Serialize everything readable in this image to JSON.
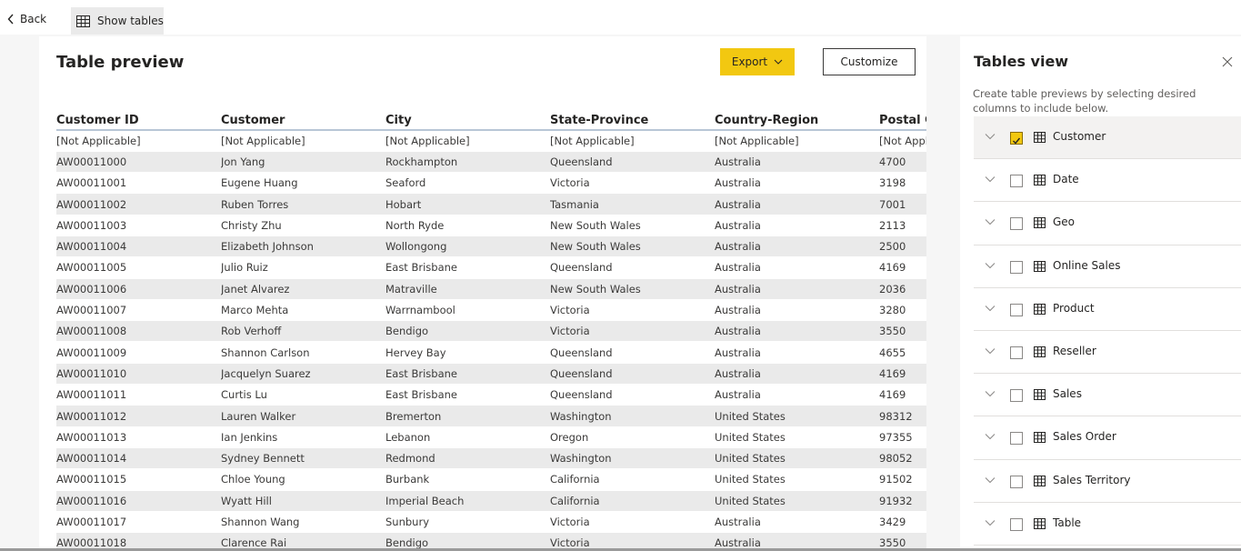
{
  "topbar": {
    "back_label": "Back",
    "show_tables_label": "Show tables"
  },
  "preview": {
    "title": "Table preview",
    "export_label": "Export",
    "customize_label": "Customize",
    "columns": [
      "Customer ID",
      "Customer",
      "City",
      "State-Province",
      "Country-Region",
      "Postal Co"
    ],
    "rows": [
      [
        "[Not Applicable]",
        "[Not Applicable]",
        "[Not Applicable]",
        "[Not Applicable]",
        "[Not Applicable]",
        "[Not Appli"
      ],
      [
        "AW00011000",
        "Jon Yang",
        "Rockhampton",
        "Queensland",
        "Australia",
        "4700"
      ],
      [
        "AW00011001",
        "Eugene Huang",
        "Seaford",
        "Victoria",
        "Australia",
        "3198"
      ],
      [
        "AW00011002",
        "Ruben Torres",
        "Hobart",
        "Tasmania",
        "Australia",
        "7001"
      ],
      [
        "AW00011003",
        "Christy Zhu",
        "North Ryde",
        "New South Wales",
        "Australia",
        "2113"
      ],
      [
        "AW00011004",
        "Elizabeth Johnson",
        "Wollongong",
        "New South Wales",
        "Australia",
        "2500"
      ],
      [
        "AW00011005",
        "Julio Ruiz",
        "East Brisbane",
        "Queensland",
        "Australia",
        "4169"
      ],
      [
        "AW00011006",
        "Janet Alvarez",
        "Matraville",
        "New South Wales",
        "Australia",
        "2036"
      ],
      [
        "AW00011007",
        "Marco Mehta",
        "Warrnambool",
        "Victoria",
        "Australia",
        "3280"
      ],
      [
        "AW00011008",
        "Rob Verhoff",
        "Bendigo",
        "Victoria",
        "Australia",
        "3550"
      ],
      [
        "AW00011009",
        "Shannon Carlson",
        "Hervey Bay",
        "Queensland",
        "Australia",
        "4655"
      ],
      [
        "AW00011010",
        "Jacquelyn Suarez",
        "East Brisbane",
        "Queensland",
        "Australia",
        "4169"
      ],
      [
        "AW00011011",
        "Curtis Lu",
        "East Brisbane",
        "Queensland",
        "Australia",
        "4169"
      ],
      [
        "AW00011012",
        "Lauren Walker",
        "Bremerton",
        "Washington",
        "United States",
        "98312"
      ],
      [
        "AW00011013",
        "Ian Jenkins",
        "Lebanon",
        "Oregon",
        "United States",
        "97355"
      ],
      [
        "AW00011014",
        "Sydney Bennett",
        "Redmond",
        "Washington",
        "United States",
        "98052"
      ],
      [
        "AW00011015",
        "Chloe Young",
        "Burbank",
        "California",
        "United States",
        "91502"
      ],
      [
        "AW00011016",
        "Wyatt Hill",
        "Imperial Beach",
        "California",
        "United States",
        "91932"
      ],
      [
        "AW00011017",
        "Shannon Wang",
        "Sunbury",
        "Victoria",
        "Australia",
        "3429"
      ],
      [
        "AW00011018",
        "Clarence Rai",
        "Bendigo",
        "Victoria",
        "Australia",
        "3550"
      ]
    ]
  },
  "tables_view": {
    "title": "Tables view",
    "description": "Create table previews by selecting desired columns to include below.",
    "tables": [
      {
        "name": "Customer",
        "checked": true
      },
      {
        "name": "Date",
        "checked": false
      },
      {
        "name": "Geo",
        "checked": false
      },
      {
        "name": "Online Sales",
        "checked": false
      },
      {
        "name": "Product",
        "checked": false
      },
      {
        "name": "Reseller",
        "checked": false
      },
      {
        "name": "Sales",
        "checked": false
      },
      {
        "name": "Sales Order",
        "checked": false
      },
      {
        "name": "Sales Territory",
        "checked": false
      },
      {
        "name": "Table",
        "checked": false
      }
    ]
  },
  "colors": {
    "accent": "#f2c811",
    "row_alt": "#eaeaea"
  }
}
